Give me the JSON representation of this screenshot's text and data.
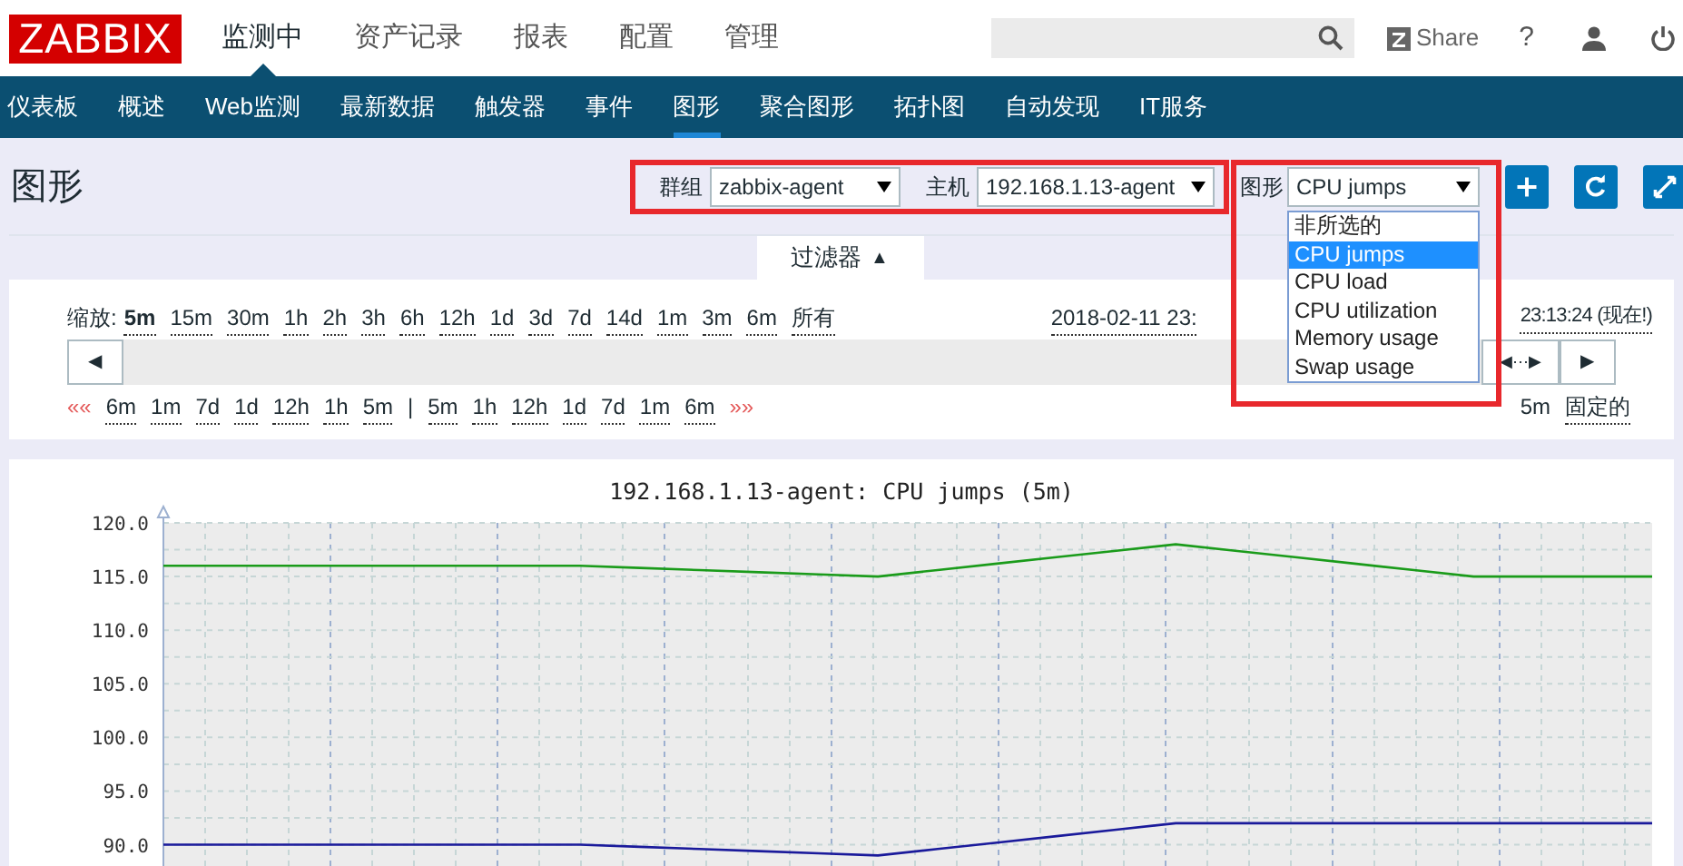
{
  "header": {
    "logo": "ZABBIX",
    "menu": [
      {
        "label": "监测中",
        "selected": true
      },
      {
        "label": "资产记录",
        "selected": false
      },
      {
        "label": "报表",
        "selected": false
      },
      {
        "label": "配置",
        "selected": false
      },
      {
        "label": "管理",
        "selected": false
      }
    ],
    "share": "Share",
    "help": "?"
  },
  "subnav": [
    {
      "label": "仪表板",
      "selected": false
    },
    {
      "label": "概述",
      "selected": false
    },
    {
      "label": "Web监测",
      "selected": false
    },
    {
      "label": "最新数据",
      "selected": false
    },
    {
      "label": "触发器",
      "selected": false
    },
    {
      "label": "事件",
      "selected": false
    },
    {
      "label": "图形",
      "selected": true
    },
    {
      "label": "聚合图形",
      "selected": false
    },
    {
      "label": "拓扑图",
      "selected": false
    },
    {
      "label": "自动发现",
      "selected": false
    },
    {
      "label": "IT服务",
      "selected": false
    }
  ],
  "page_title": "图形",
  "filters": [
    {
      "label": "群组",
      "value": "zabbix-agent"
    },
    {
      "label": "主机",
      "value": "192.168.1.13-agent"
    },
    {
      "label": "图形",
      "value": "CPU jumps"
    }
  ],
  "graph_dropdown": {
    "options": [
      {
        "label": "非所选的",
        "selected": false
      },
      {
        "label": "CPU jumps",
        "selected": true
      },
      {
        "label": "CPU load",
        "selected": false
      },
      {
        "label": "CPU utilization",
        "selected": false
      },
      {
        "label": "Memory usage",
        "selected": false
      },
      {
        "label": "Swap usage",
        "selected": false
      }
    ]
  },
  "filter_tab": {
    "label": "过滤器",
    "arrow": "▲"
  },
  "zoom": {
    "label": "缩放:",
    "options": [
      {
        "label": "5m",
        "selected": true
      },
      {
        "label": "15m",
        "selected": false
      },
      {
        "label": "30m",
        "selected": false
      },
      {
        "label": "1h",
        "selected": false
      },
      {
        "label": "2h",
        "selected": false
      },
      {
        "label": "3h",
        "selected": false
      },
      {
        "label": "6h",
        "selected": false
      },
      {
        "label": "12h",
        "selected": false
      },
      {
        "label": "1d",
        "selected": false
      },
      {
        "label": "3d",
        "selected": false
      },
      {
        "label": "7d",
        "selected": false
      },
      {
        "label": "14d",
        "selected": false
      },
      {
        "label": "1m",
        "selected": false
      },
      {
        "label": "3m",
        "selected": false
      },
      {
        "label": "6m",
        "selected": false
      },
      {
        "label": "所有",
        "selected": false
      }
    ]
  },
  "time_from": "2018-02-11 23:",
  "time_to": "23:13:24 (现在!)",
  "scroll_buttons": {
    "left": "◀",
    "middle": "◀⋯▶",
    "right": "▶"
  },
  "nav": {
    "back": "««",
    "back_links": [
      "6m",
      "1m",
      "7d",
      "1d",
      "12h",
      "1h",
      "5m"
    ],
    "separator": "|",
    "forward_links": [
      "5m",
      "1h",
      "12h",
      "1d",
      "7d",
      "1m",
      "6m"
    ],
    "forward": "»»"
  },
  "period": "5m",
  "fixed": "固定的",
  "chart": {
    "chart_data": {
      "type": "line",
      "grid": true,
      "title": "192.168.1.13-agent: CPU jumps (5m)",
      "categories": [
        null,
        null,
        null,
        null,
        null,
        null,
        null,
        null,
        null,
        null,
        null,
        null,
        null,
        null,
        null,
        null,
        null,
        null,
        null,
        null,
        null,
        null,
        null,
        null,
        null,
        null
      ],
      "ylim": [
        87,
        120
      ],
      "yticks": [
        {
          "value": 90,
          "label": "90.0"
        },
        {
          "value": 95,
          "label": "95.0"
        },
        {
          "value": 100,
          "label": "100.0"
        },
        {
          "value": 105,
          "label": "105.0"
        },
        {
          "value": 110,
          "label": "110.0"
        },
        {
          "value": 115,
          "label": "115.0"
        },
        {
          "value": 120,
          "label": "120.0"
        }
      ],
      "series": [
        {
          "color": "#1a9b1a",
          "values": [
            116,
            116,
            116,
            116,
            116,
            116,
            116,
            116,
            115.8,
            115.6,
            115.4,
            115.2,
            115,
            115.6,
            116.2,
            116.8,
            117.4,
            118,
            117.4,
            116.8,
            116.2,
            115.6,
            115,
            115,
            115,
            115
          ]
        },
        {
          "color": "#1a1a9b",
          "values": [
            90,
            90,
            90,
            90,
            90,
            90,
            90,
            90,
            89.8,
            89.6,
            89.4,
            89.2,
            89,
            89.6,
            90.2,
            90.8,
            91.4,
            92,
            92,
            92,
            92,
            92,
            92,
            92,
            92,
            92
          ]
        }
      ]
    }
  }
}
